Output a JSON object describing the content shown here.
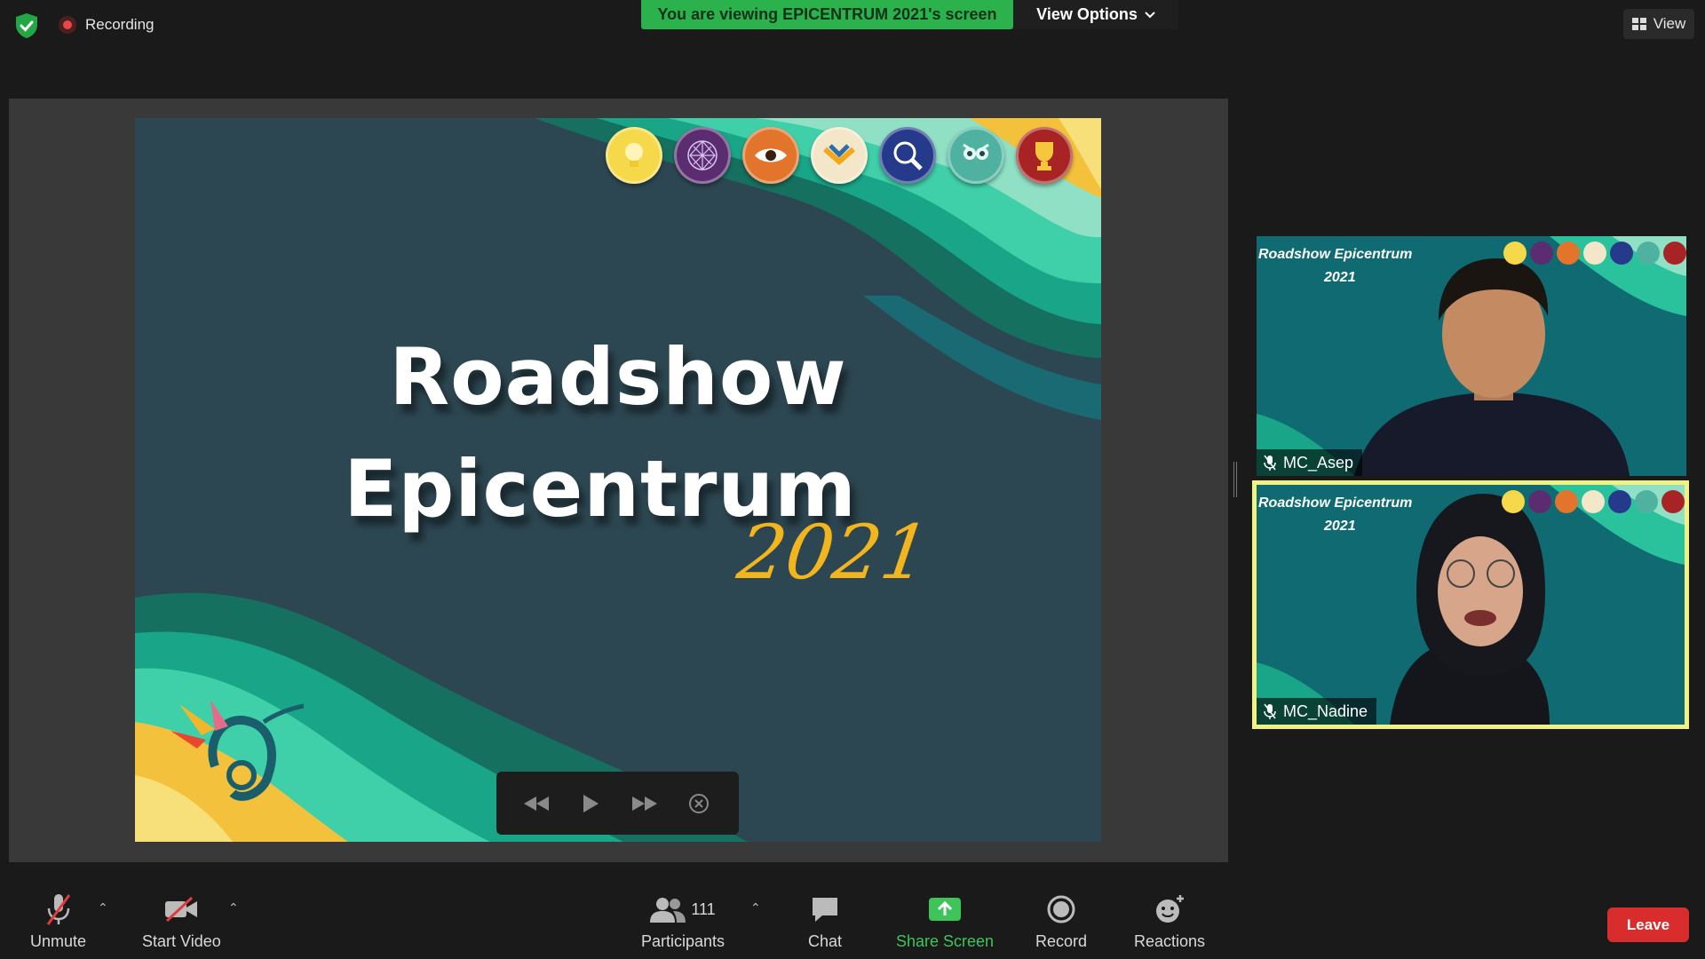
{
  "topbar": {
    "recording_label": "Recording",
    "viewing_banner": "You are viewing EPICENTRUM 2021's screen",
    "view_options_label": "View Options",
    "view_label": "View"
  },
  "slide": {
    "title_line1": "Roadshow",
    "title_line2": "Epicentrum",
    "year": "2021",
    "badges": [
      {
        "icon": "lightbulb-icon",
        "color": "#f6d94a"
      },
      {
        "icon": "network-icon",
        "color": "#5b2c6f"
      },
      {
        "icon": "eye-icon",
        "color": "#e2742c"
      },
      {
        "icon": "gears-icon",
        "color": "#f4e6c8"
      },
      {
        "icon": "magnifier-icon",
        "color": "#253a8a"
      },
      {
        "icon": "owl-icon",
        "color": "#4fb2a0"
      },
      {
        "icon": "trophy-icon",
        "color": "#a82323"
      }
    ]
  },
  "participants_tiles": [
    {
      "name": "MC_Asep",
      "overlay_title": "Roadshow Epicentrum",
      "overlay_year": "2021"
    },
    {
      "name": "MC_Nadine",
      "overlay_title": "Roadshow Epicentrum",
      "overlay_year": "2021"
    }
  ],
  "toolbar": {
    "unmute": "Unmute",
    "start_video": "Start Video",
    "participants": "Participants",
    "participants_count": "111",
    "chat": "Chat",
    "share_screen": "Share Screen",
    "record": "Record",
    "reactions": "Reactions",
    "leave": "Leave"
  },
  "colors": {
    "share_green": "#2bb24c",
    "leave_red": "#d92c2c",
    "speaker_border": "#f0f284",
    "slide_bg": "#2c4652"
  }
}
